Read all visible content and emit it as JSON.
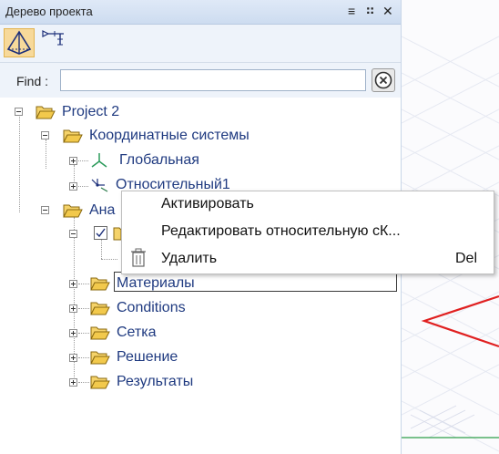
{
  "panel": {
    "title": "Дерево проекта",
    "controls": {
      "menu_glyph": "≡",
      "dock_glyph": "⠶",
      "close_glyph": "✕"
    }
  },
  "toolbar": {
    "main_icon": "pyramid-icon",
    "dim_icon": "dimension-icon"
  },
  "find": {
    "label": "Find :",
    "value": "",
    "placeholder": "",
    "clear_icon": "clear-circle-icon"
  },
  "tree": {
    "project": "Project 2",
    "coord_systems": "Координатные системы",
    "global": "Глобальная",
    "relative": "Относительный1",
    "analysis_partial": "Ана",
    "materials": "Материалы",
    "conditions": "Conditions",
    "mesh": "Сетка",
    "solution": "Решение",
    "results": "Результаты"
  },
  "context_menu": {
    "items": [
      {
        "label": "Активировать",
        "shortcut": ""
      },
      {
        "label": "Редактировать относительную сК...",
        "shortcut": ""
      },
      {
        "label": "Удалить",
        "shortcut": "Del",
        "icon": "trash-icon"
      }
    ]
  },
  "colors": {
    "folder": "#f2c94c",
    "accent": "#f7d99a",
    "tree_text": "#1f3a80",
    "shape_red": "#e02020",
    "axis_green": "#2e9e4a"
  }
}
